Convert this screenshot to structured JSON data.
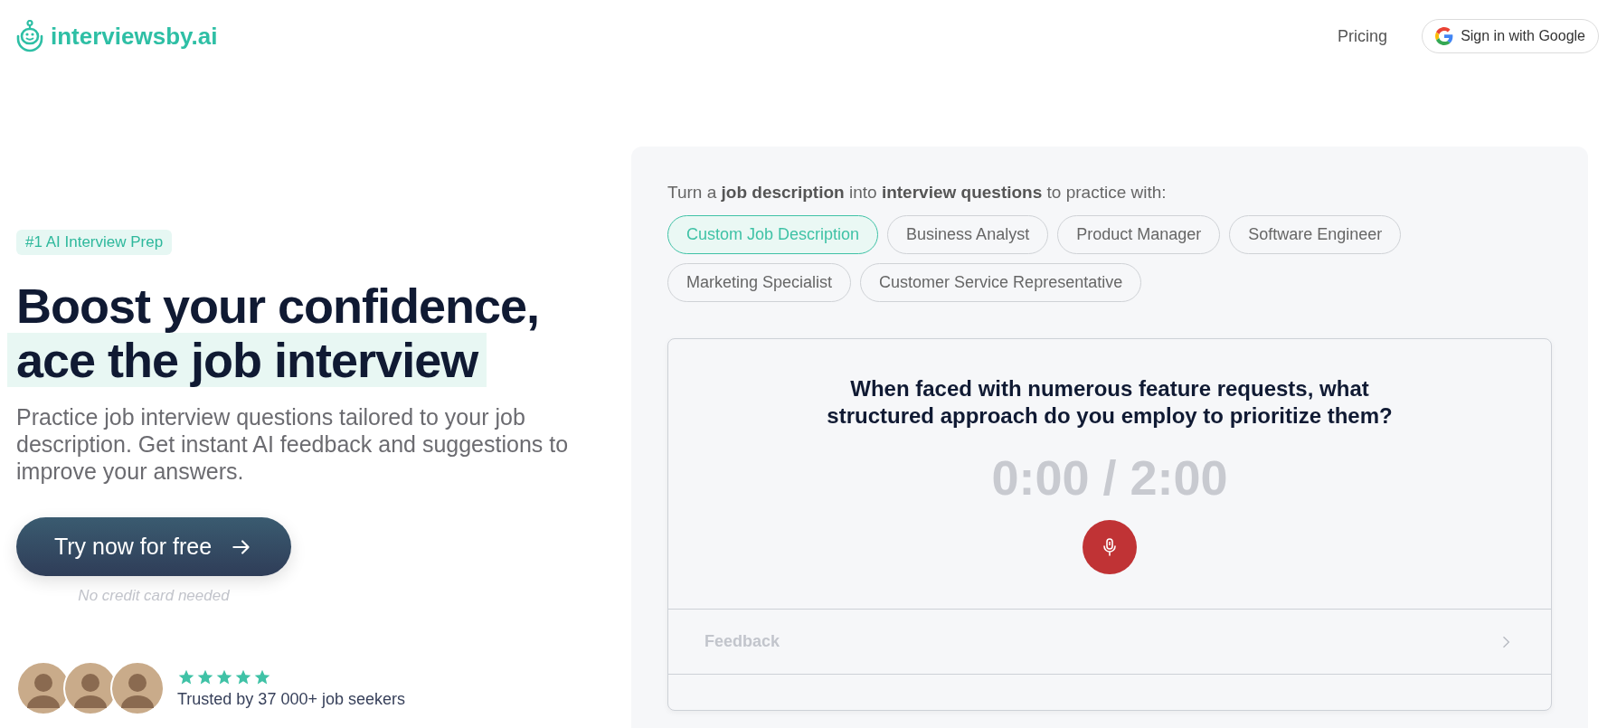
{
  "header": {
    "logo": "interviewsby.ai",
    "nav": [
      {
        "label": "Pricing"
      }
    ],
    "sign_in": "Sign in with Google"
  },
  "hero": {
    "badge": "#1 AI Interview Prep",
    "headline_lines": [
      "Boost your confidence,",
      "ace the job interview"
    ],
    "description": "Practice job interview questions tailored to your job description. Get instant AI feedback and suggestions to improve your answers.",
    "cta": "Try now for free",
    "cta_note": "No credit card needed",
    "stars": 5,
    "trust": "Trusted by 37 000+ job seekers"
  },
  "demo": {
    "intro": "Turn a **job description** into **interview questions** to practice with:",
    "roles": [
      {
        "label": "Custom Job Description",
        "selected": true
      },
      {
        "label": "Business Analyst",
        "selected": false
      },
      {
        "label": "Product Manager",
        "selected": false
      },
      {
        "label": "Software Engineer",
        "selected": false
      },
      {
        "label": "Marketing Specialist",
        "selected": false
      },
      {
        "label": "Customer Service Representative",
        "selected": false
      }
    ],
    "question": "When faced with numerous feature requests, what structured approach do you employ to prioritize them?",
    "timer": "0:00 / 2:00",
    "sections": [
      {
        "label": "Feedback",
        "expanded": false
      }
    ]
  }
}
